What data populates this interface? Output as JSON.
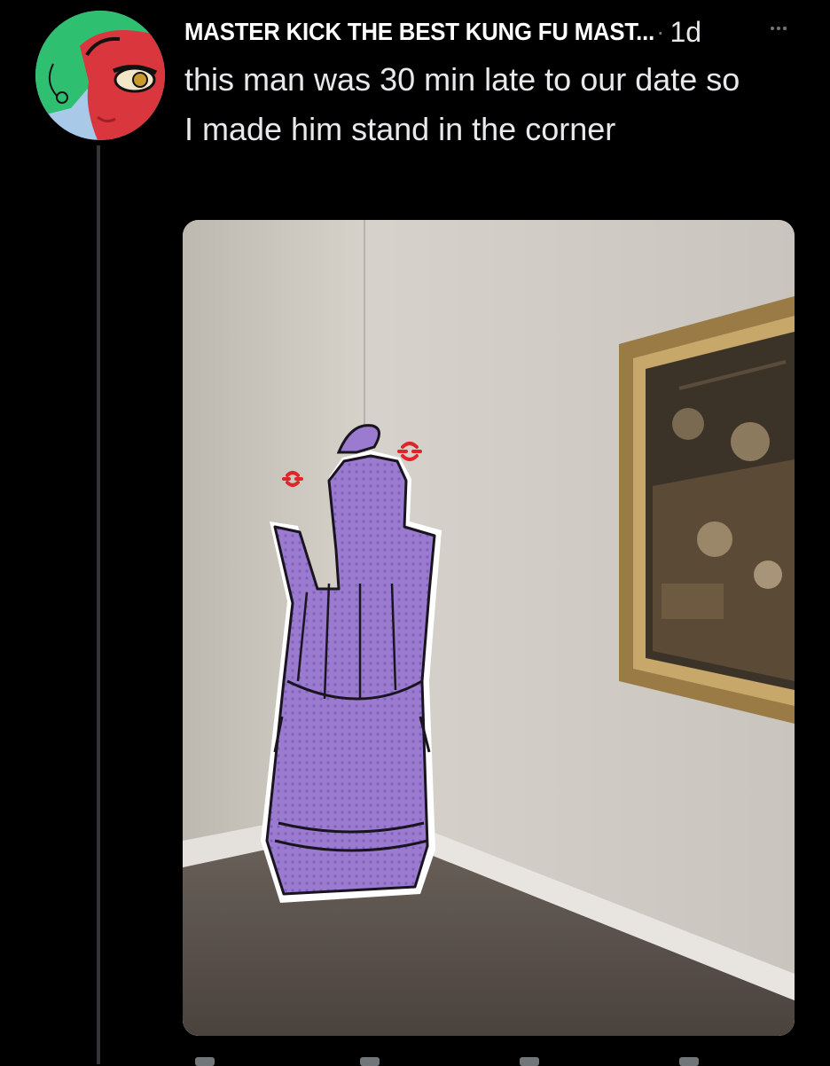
{
  "tweet": {
    "display_name": "MASTER KICK THE BEST KUNG FU MAST...",
    "separator": "·",
    "timestamp": "1d",
    "text": "this man was 30 min late to our date so I made him stand in the corner"
  },
  "icons": {
    "more": "more-horizontal-icon",
    "anger": "anger-symbol-icon"
  },
  "colors": {
    "background": "#000000",
    "text": "#e7e9ea",
    "secondary": "#71767b",
    "thread_line": "#333639",
    "avatar_green": "#2fbf71",
    "avatar_red": "#d9363e",
    "avatar_blue": "#a8c9e8",
    "figure_purple": "#9a7bd0",
    "anger_red": "#e0242b"
  }
}
